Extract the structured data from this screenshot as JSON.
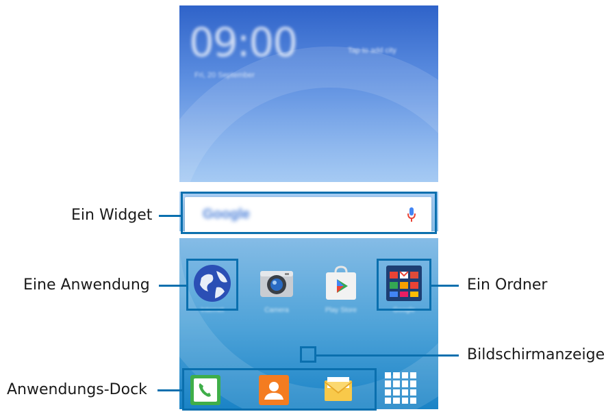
{
  "callouts": {
    "widget": "Ein Widget",
    "app": "Eine Anwendung",
    "folder": "Ein Ordner",
    "indicator": "Bildschirmanzeige",
    "dock": "Anwendungs-Dock"
  },
  "phone": {
    "clock": "09:00",
    "date": "Fri, 20 September",
    "weather_hint": "Tap to add city",
    "search_widget": {
      "brand": "Google",
      "icon": "mic-icon"
    },
    "apps": [
      {
        "label": "Internet",
        "icon": "globe-icon"
      },
      {
        "label": "Camera",
        "icon": "camera-icon"
      },
      {
        "label": "Play Store",
        "icon": "play-store-icon"
      },
      {
        "label": "Google",
        "icon": "folder-icon"
      }
    ],
    "dock": [
      {
        "label": "Phone",
        "icon": "phone-icon"
      },
      {
        "label": "Contacts",
        "icon": "contacts-icon"
      },
      {
        "label": "Messages",
        "icon": "messages-icon"
      },
      {
        "label": "Apps",
        "icon": "apps-grid-icon"
      }
    ]
  },
  "colors": {
    "callout": "#0a6fae"
  }
}
